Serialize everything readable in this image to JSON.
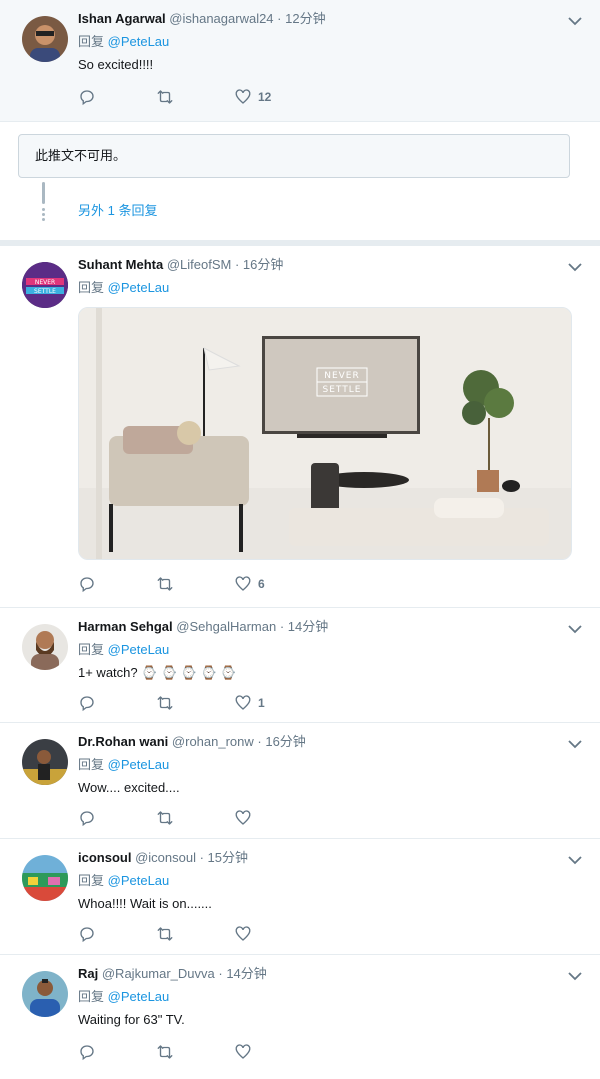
{
  "tweets": [
    {
      "name": "Ishan Agarwal",
      "handle": "@ishanagarwal24",
      "sep": " · ",
      "time": "12分钟",
      "reply_prefix": "回复 ",
      "mention": "@PeteLau",
      "text": "So excited!!!!",
      "likes": "12"
    },
    {
      "name": "Suhant Mehta",
      "handle": "@LifeofSM",
      "sep": " · ",
      "time": "16分钟",
      "reply_prefix": "回复 ",
      "mention": "@PeteLau",
      "likes": "6",
      "media_text": [
        "NEVER",
        "SETTLE"
      ]
    },
    {
      "name": "Harman Sehgal",
      "handle": "@SehgalHarman",
      "sep": " · ",
      "time": "14分钟",
      "reply_prefix": "回复 ",
      "mention": "@PeteLau",
      "text": "1+ watch? ⌚ ⌚ ⌚ ⌚ ⌚",
      "likes": "1"
    },
    {
      "name": "Dr.Rohan wani",
      "handle": "@rohan_ronw",
      "sep": " · ",
      "time": "16分钟",
      "reply_prefix": "回复 ",
      "mention": "@PeteLau",
      "text": "Wow.... excited...."
    },
    {
      "name": "iconsoul",
      "handle": "@iconsoul",
      "sep": " · ",
      "time": "15分钟",
      "reply_prefix": "回复 ",
      "mention": "@PeteLau",
      "text": "Whoa!!!! Wait is on......."
    },
    {
      "name": "Raj",
      "handle": "@Rajkumar_Duvva",
      "sep": " · ",
      "time": "14分钟",
      "reply_prefix": "回复 ",
      "mention": "@PeteLau",
      "text": "Waiting for 63\" TV."
    }
  ],
  "unavailable_text": "此推文不可用。",
  "more_replies": "另外 1 条回复",
  "colors": {
    "link": "#1b95e0",
    "muted": "#657786",
    "border": "#e6ecf0",
    "highlight": "#f5f8fa"
  },
  "icons": [
    "reply-icon",
    "retweet-icon",
    "like-icon",
    "chevron-down-icon"
  ]
}
